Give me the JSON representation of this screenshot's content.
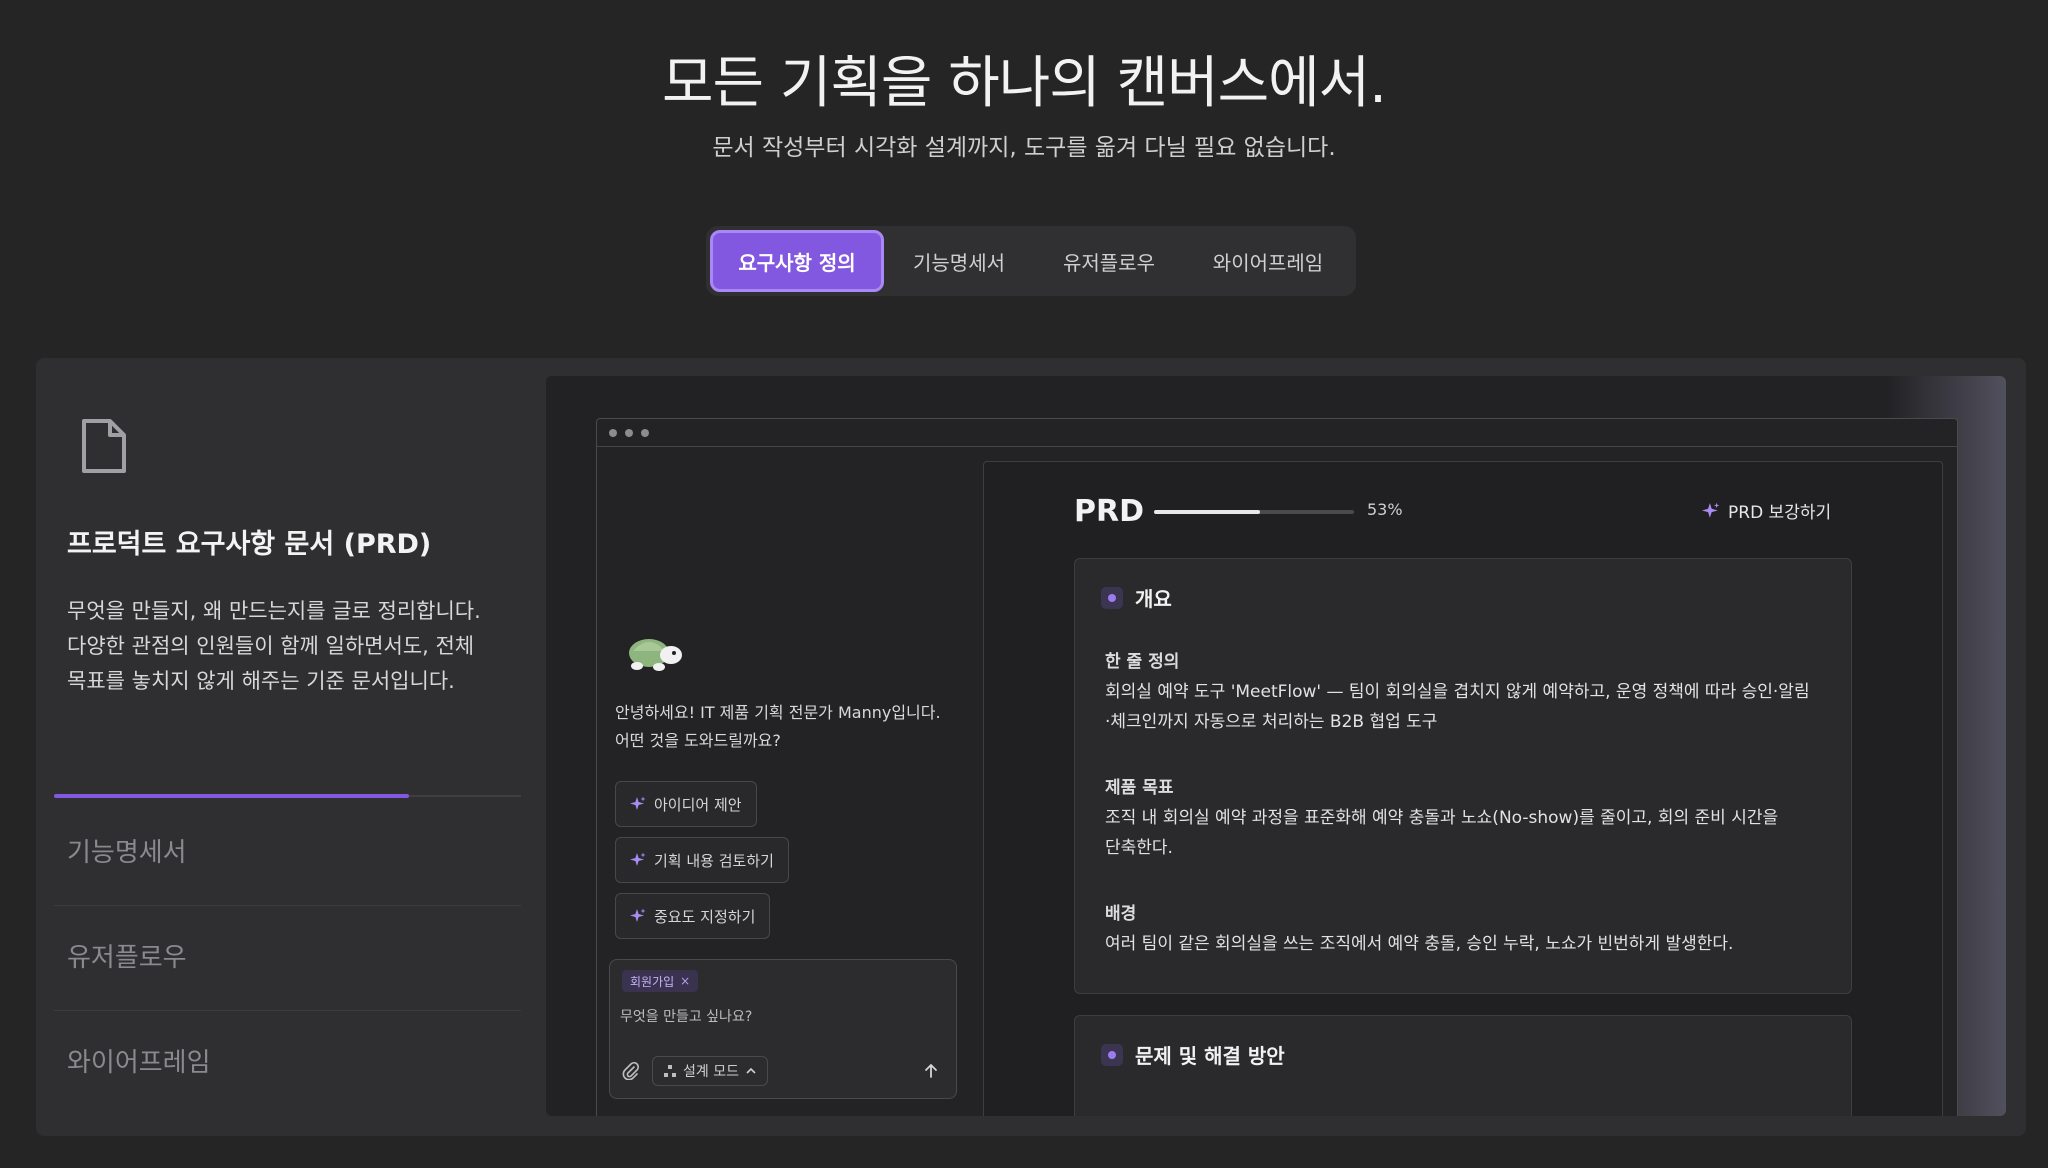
{
  "hero": {
    "title": "모든 기획을 하나의 캔버스에서.",
    "subtitle": "문서 작성부터 시각화 설계까지, 도구를 옮겨 다닐 필요 없습니다."
  },
  "tabs": [
    {
      "label": "요구사항 정의",
      "active": true
    },
    {
      "label": "기능명세서",
      "active": false
    },
    {
      "label": "유저플로우",
      "active": false
    },
    {
      "label": "와이어프레임",
      "active": false
    }
  ],
  "left": {
    "icon": "document-icon",
    "title": "프로덕트 요구사항 문서 (PRD)",
    "desc": [
      "무엇을 만들지, 왜 만드는지를 글로 정리합니다.",
      "다양한 관점의 인원들이 함께 일하면서도, 전체",
      "목표를 놓치지 않게 해주는 기준 문서입니다."
    ],
    "progress_fraction": 0.76,
    "items": [
      "기능명세서",
      "유저플로우",
      "와이어프레임"
    ]
  },
  "chat": {
    "greeting": [
      "안녕하세요! IT 제품 기획 전문가 Manny입니다.",
      "어떤 것을 도와드릴까요?"
    ],
    "suggestions": [
      "아이디어 제안",
      "기획 내용 검토하기",
      "중요도 지정하기"
    ],
    "composer": {
      "tag": "회원가입",
      "tag_remove": "×",
      "placeholder": "무엇을 만들고 싶나요?",
      "mode_label": "설계 모드"
    }
  },
  "doc": {
    "title": "PRD",
    "progress_percent": 53,
    "progress_label": "53%",
    "enhance_label": "PRD 보강하기",
    "sections": [
      {
        "heading": "개요",
        "blocks": [
          {
            "label": "한 줄 정의",
            "lines": [
              "회의실 예약 도구 'MeetFlow' — 팀이 회의실을 겹치지 않게 예약하고, 운영 정책에 따라 승인·알림",
              "·체크인까지 자동으로 처리하는 B2B 협업 도구"
            ]
          },
          {
            "label": "제품 목표",
            "lines": [
              "조직 내 회의실 예약 과정을 표준화해 예약 충돌과 노쇼(No-show)를 줄이고, 회의 준비 시간을",
              "단축한다."
            ]
          },
          {
            "label": "배경",
            "lines": [
              "여러 팀이 같은 회의실을 쓰는 조직에서 예약 충돌, 승인 누락, 노쇼가 빈번하게 발생한다."
            ]
          }
        ]
      },
      {
        "heading": "문제 및 해결 방안",
        "blocks": []
      }
    ]
  },
  "colors": {
    "background": "#252526",
    "accent": "#8358e0",
    "panel": "#2f2f31"
  }
}
